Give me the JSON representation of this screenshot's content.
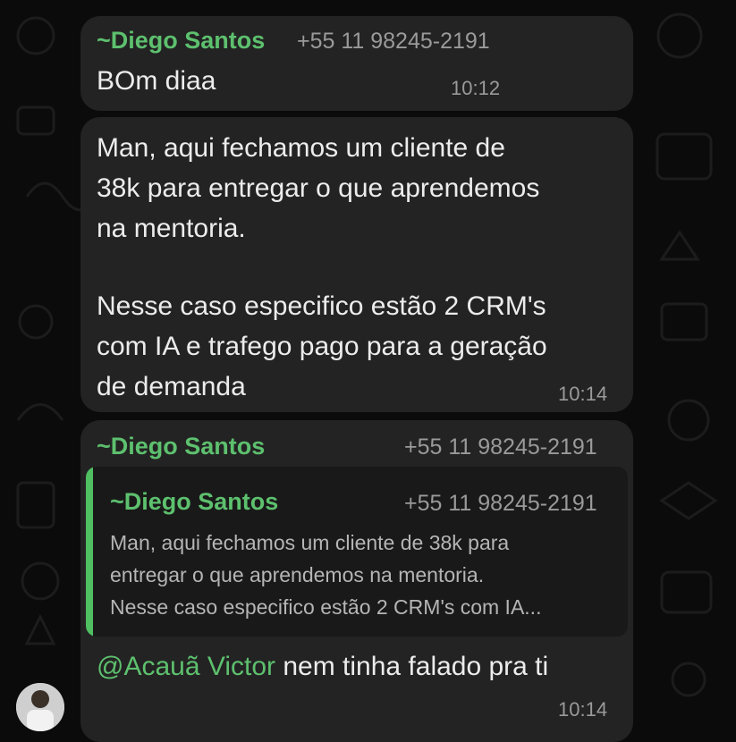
{
  "messages": [
    {
      "sender": "~Diego Santos",
      "phone": "+55 11 98245-2191",
      "text": "BOm diaa",
      "time": "10:12"
    },
    {
      "lines": [
        "Man, aqui fechamos um cliente de",
        "38k para entregar o que aprendemos",
        "na mentoria.",
        "",
        "Nesse caso especifico estão 2 CRM's",
        "com IA e trafego pago para a geração",
        "de demanda"
      ],
      "time": "10:14"
    },
    {
      "sender": "~Diego Santos",
      "phone": "+55 11 98245-2191",
      "quote": {
        "sender": "~Diego Santos",
        "phone": "+55 11 98245-2191",
        "lines": [
          "Man, aqui fechamos um cliente de 38k para",
          "entregar o que aprendemos na mentoria.",
          "Nesse caso especifico estão 2 CRM's com IA..."
        ]
      },
      "mention": "@Acauã Victor",
      "text": " nem tinha falado pra ti",
      "time": "10:14"
    }
  ],
  "colors": {
    "background": "#0b0b0b",
    "bubble": "#232323",
    "sender_name": "#5dc06e",
    "quote_bar": "#4fbf62"
  }
}
